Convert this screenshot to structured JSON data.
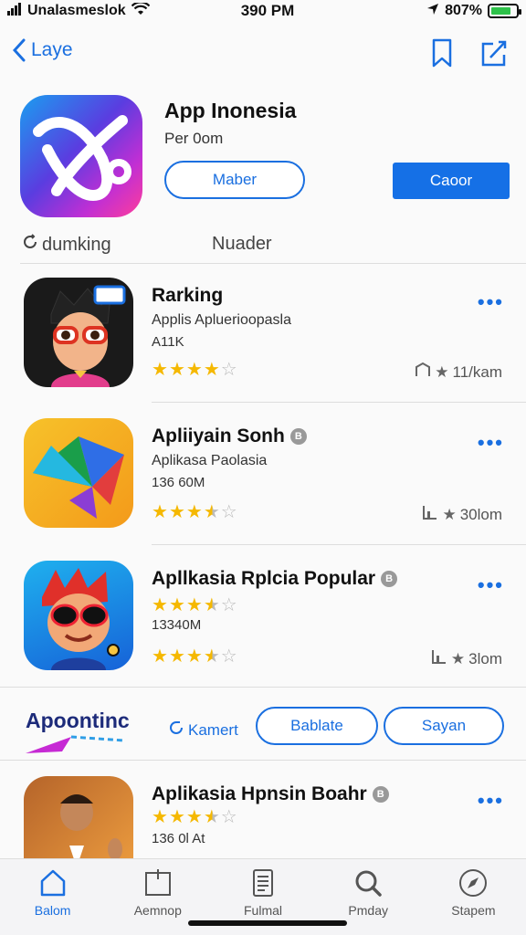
{
  "status": {
    "carrier": "Unalasmeslok",
    "time": "390 PM",
    "battery": "807%",
    "battery_level": 0.8
  },
  "nav": {
    "back_label": "Laye"
  },
  "featured": {
    "title": "App Inonesia",
    "subtitle": "Per 0om",
    "button_outline": "Maber",
    "button_solid": "Caoor",
    "caption_left": "dumking",
    "caption_right": "Nuader"
  },
  "apps": [
    {
      "title": "Rarking",
      "line2": "Applis Apluerioopasla",
      "line3": "A11K",
      "rating": 4,
      "stat": "11/kam",
      "badge": ""
    },
    {
      "title": "Apliiyain Sonh",
      "line2": "Aplikasa Paolasia",
      "line3": "136 60M",
      "rating": 3.5,
      "stat": "30lom",
      "badge": "B"
    },
    {
      "title": "Apllkasia Rplcia Popular",
      "line2": "",
      "line3": "13340M",
      "rating": 3.5,
      "stat": "3lom",
      "badge": "B"
    },
    {
      "title": "Aplikasia Hpnsin Boahr",
      "line2": "",
      "line3": "136 0l At",
      "rating": 3.5,
      "stat": "",
      "badge": "B"
    }
  ],
  "promo": {
    "logo": "Apoontinc",
    "link": "Kamert",
    "button1": "Bablate",
    "button2": "Sayan"
  },
  "tabs": [
    {
      "label": "Balom",
      "icon": "home-icon"
    },
    {
      "label": "Aemnop",
      "icon": "clipboard-icon"
    },
    {
      "label": "Fulmal",
      "icon": "document-icon"
    },
    {
      "label": "Pmday",
      "icon": "search-icon"
    },
    {
      "label": "Stapem",
      "icon": "compass-icon"
    }
  ],
  "colors": {
    "accent": "#1a6fe0",
    "star": "#f5b800"
  }
}
